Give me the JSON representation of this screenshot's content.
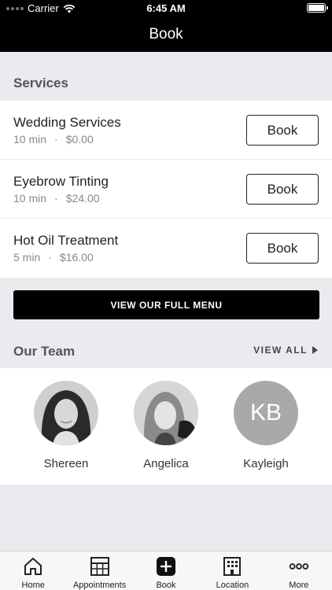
{
  "status_bar": {
    "carrier": "Carrier",
    "time": "6:45 AM"
  },
  "nav": {
    "title": "Book"
  },
  "services": {
    "header": "Services",
    "items": [
      {
        "name": "Wedding Services",
        "duration": "10 min",
        "price": "$0.00",
        "button": "Book"
      },
      {
        "name": "Eyebrow Tinting",
        "duration": "10 min",
        "price": "$24.00",
        "button": "Book"
      },
      {
        "name": "Hot Oil Treatment",
        "duration": "5 min",
        "price": "$16.00",
        "button": "Book"
      }
    ],
    "separator": "·"
  },
  "full_menu_button": "VIEW OUR FULL MENU",
  "team": {
    "header": "Our Team",
    "view_all": "VIEW ALL",
    "members": [
      {
        "name": "Shereen",
        "avatar": "photo"
      },
      {
        "name": "Angelica",
        "avatar": "photo"
      },
      {
        "name": "Kayleigh",
        "avatar": "initials",
        "initials": "KB"
      }
    ]
  },
  "tabbar": {
    "items": [
      {
        "label": "Home",
        "icon": "home-icon"
      },
      {
        "label": "Appointments",
        "icon": "calendar-grid-icon"
      },
      {
        "label": "Book",
        "icon": "plus-square-icon"
      },
      {
        "label": "Location",
        "icon": "building-icon"
      },
      {
        "label": "More",
        "icon": "more-dots-icon"
      }
    ]
  },
  "colors": {
    "nav_bg": "#000000",
    "page_bg": "#e9ebef",
    "accent": "#000000",
    "initials_bg": "#a9a9a9"
  }
}
